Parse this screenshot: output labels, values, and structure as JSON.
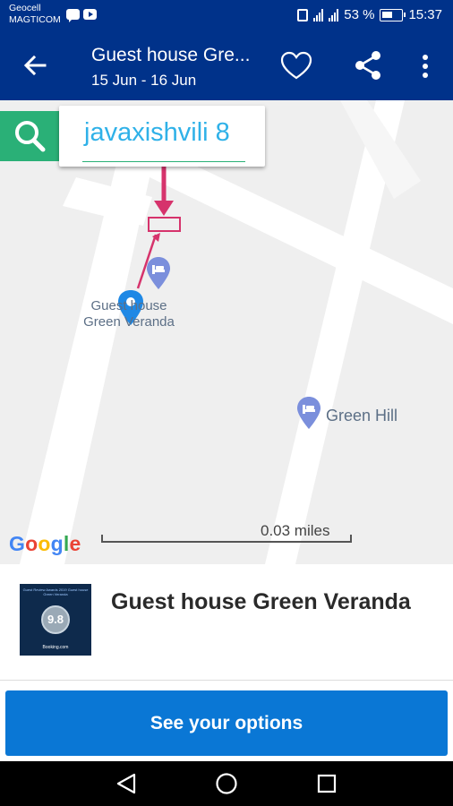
{
  "status_bar": {
    "carrier_line1": "Geocell",
    "carrier_line2": "MAGTICOM",
    "battery_percent": "53 %",
    "time": "15:37"
  },
  "app_bar": {
    "title": "Guest house Gre...",
    "dates": "15 Jun - 16 Jun"
  },
  "search_annotation": {
    "text": "javaxishvili 8",
    "color": "#2fb1e8"
  },
  "map": {
    "pins": [
      {
        "label_line1": "Guest house",
        "label_line2": "Green Veranda"
      },
      {
        "label": "Green Hill"
      }
    ],
    "scale_label": "0.03 miles",
    "logo": [
      "G",
      "o",
      "o",
      "g",
      "l",
      "e"
    ],
    "logo_colors": [
      "#4285f4",
      "#ea4335",
      "#fbbc05",
      "#4285f4",
      "#34a853",
      "#ea4335"
    ]
  },
  "hotel": {
    "name": "Guest house Green Veranda",
    "thumb_score": "9.8",
    "thumb_top": "Guest Review Awards 2019 Guest house Green Veranda",
    "thumb_bottom": "Booking.com"
  },
  "cta": {
    "label": "See your options"
  },
  "colors": {
    "app_bar": "#00328a",
    "cta": "#0a77d5",
    "annotation": "#d6336c",
    "search_green": "#2ab077"
  }
}
